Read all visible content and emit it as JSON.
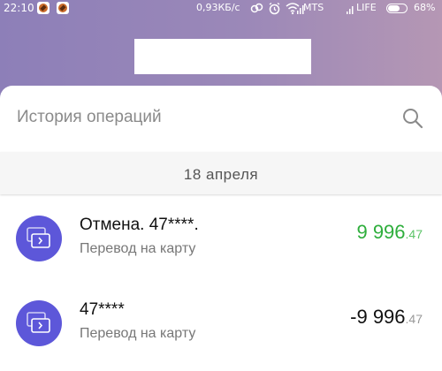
{
  "status_bar": {
    "time": "22:10",
    "speed": "0,93КБ/с",
    "carrier1": "MTS",
    "carrier2": "LIFE",
    "battery": "68%",
    "battery_level": 0.68
  },
  "search": {
    "placeholder": "История операций"
  },
  "date_header": "18 апреля",
  "transactions": [
    {
      "title": "Отмена. 47****.",
      "subtitle": "Перевод на карту",
      "amount_main": "9 996",
      "amount_cents": ".47",
      "sign": "positive"
    },
    {
      "title": "47****",
      "subtitle": "Перевод на карту",
      "amount_main": "-9 996",
      "amount_cents": ".47",
      "sign": "negative"
    }
  ],
  "colors": {
    "accent": "#5d57d9",
    "positive": "#2eae3c",
    "negative": "#111111"
  }
}
